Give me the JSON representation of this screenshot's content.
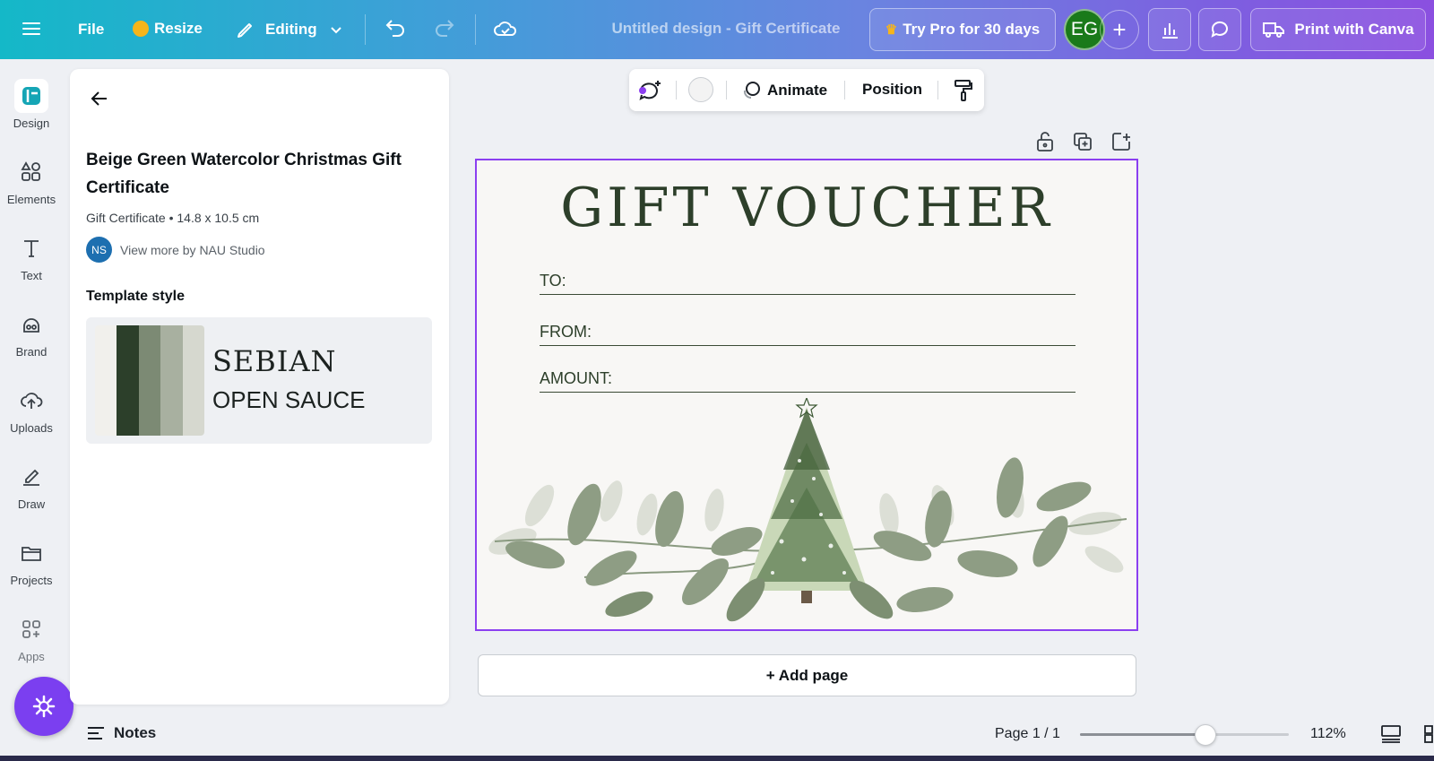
{
  "topbar": {
    "menu_icon": "hamburger-icon",
    "file_label": "File",
    "resize_label": "Resize",
    "editing_label": "Editing",
    "document_title": "Untitled design - Gift Certificate",
    "try_pro_label": "Try Pro for 30 days",
    "avatar_initials": "EG",
    "print_label": "Print with Canva"
  },
  "rail": {
    "items": [
      {
        "label": "Design",
        "icon": "design-icon"
      },
      {
        "label": "Elements",
        "icon": "elements-icon"
      },
      {
        "label": "Text",
        "icon": "text-icon"
      },
      {
        "label": "Brand",
        "icon": "brand-icon"
      },
      {
        "label": "Uploads",
        "icon": "uploads-icon"
      },
      {
        "label": "Draw",
        "icon": "draw-icon"
      },
      {
        "label": "Projects",
        "icon": "projects-icon"
      },
      {
        "label": "Apps",
        "icon": "apps-icon"
      }
    ]
  },
  "panel": {
    "title": "Beige Green Watercolor Christmas Gift Certificate",
    "meta": "Gift Certificate • 14.8 x 10.5 cm",
    "author_initials": "NS",
    "author_link": "View more by NAU Studio",
    "style_heading": "Template style",
    "font_heading": "SEBIAN",
    "font_body": "OPEN SAUCE",
    "swatch_colors": [
      "#f1f0ec",
      "#2c3f2a",
      "#7c8a74",
      "#a8b0a0",
      "#d6d8cf"
    ]
  },
  "float_toolbar": {
    "animate_label": "Animate",
    "position_label": "Position"
  },
  "canvas": {
    "title": "GIFT VOUCHER",
    "field_to": "TO:",
    "field_from": "FROM:",
    "field_amount": "AMOUNT:",
    "add_page_label": "+ Add page"
  },
  "bottom": {
    "notes_label": "Notes",
    "page_indicator": "Page 1 / 1",
    "zoom_label": "112%",
    "zoom_fraction": 0.6
  },
  "colors": {
    "accent_purple": "#8b3ff0",
    "forest_green": "#2d3f2a"
  }
}
